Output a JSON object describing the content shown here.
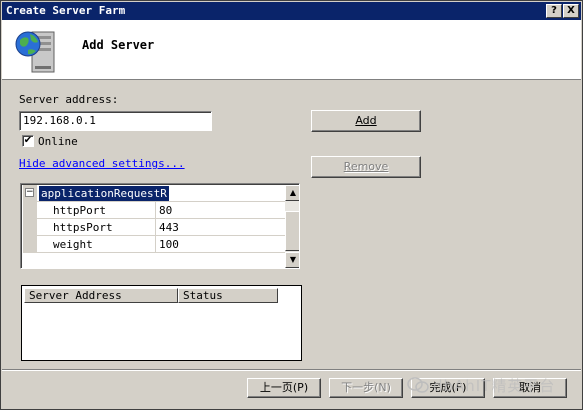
{
  "window": {
    "title": "Create Server Farm",
    "help_glyph": "?",
    "close_glyph": "X"
  },
  "header": {
    "title": "Add Server",
    "icon": "server-globe-icon"
  },
  "form": {
    "server_address_label": "Server address:",
    "server_address_value": "192.168.0.1",
    "online_label": "Online",
    "online_checked": true,
    "online_check_glyph": "✔",
    "advanced_link": "Hide advanced settings...",
    "add_button": "Add",
    "remove_button": "Remove"
  },
  "property_grid": {
    "category": "applicationRequestR",
    "expander_glyph": "−",
    "rows": [
      {
        "name": "httpPort",
        "value": "80"
      },
      {
        "name": "httpsPort",
        "value": "443"
      },
      {
        "name": "weight",
        "value": "100"
      }
    ],
    "scroll_up_glyph": "▲",
    "scroll_down_glyph": "▼"
  },
  "server_list": {
    "columns": [
      "Server Address",
      "Status"
    ],
    "rows": []
  },
  "footer": {
    "back_button": "上一页(P)",
    "next_button": "下一步(N)",
    "finish_button": "完成(F)",
    "cancel_button": "取消"
  },
  "watermark": {
    "text": "dbAhIT精英平台"
  },
  "colors": {
    "titlebar": "#0a246a",
    "dialog_face": "#d4d0c8",
    "link": "#0000ff",
    "selection": "#0a246a"
  }
}
